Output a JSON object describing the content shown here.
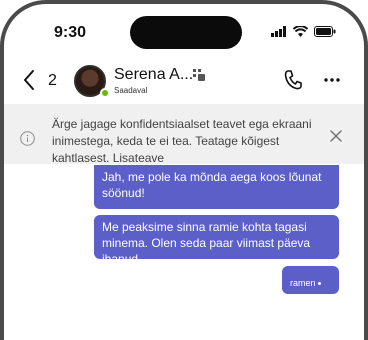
{
  "status_bar": {
    "time": "9:30",
    "icons": [
      "signal-icon",
      "wifi-icon",
      "battery-icon"
    ]
  },
  "header": {
    "back_count": "2",
    "contact_name": "Serena A...",
    "contact_status": "Saadaval",
    "icons": [
      "back-chevron-icon",
      "organization-icon",
      "phone-icon",
      "more-icon"
    ],
    "presence_color": "#6bb700"
  },
  "banner": {
    "text": "Ärge jagage konfidentsiaalset teavet ega ekraani inimestega, keda te ei tea. Teatage kõigest kahtlasest.",
    "link": "Lisateave"
  },
  "messages": [
    {
      "text": "Jah, me pole ka mõnda aega koos lõunat söönud!"
    },
    {
      "text": "Me peaksime sinna ramie kohta tagasi minema. Olen seda paar viimast päeva ihanud."
    },
    {
      "text": "ramen"
    }
  ],
  "colors": {
    "bubble": "#5b5fc7",
    "banner_bg": "#f0f0f0"
  }
}
